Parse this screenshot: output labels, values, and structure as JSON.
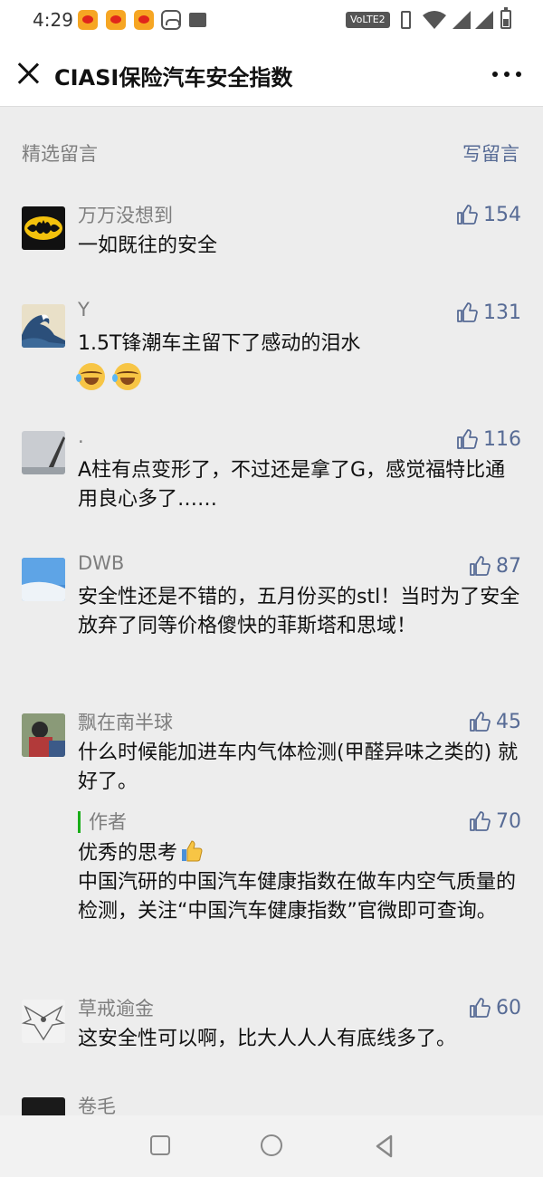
{
  "status_bar": {
    "time": "4:29",
    "network_badge": "VoLTE2",
    "icons": [
      "weibo-icon",
      "weibo-icon",
      "weibo-icon",
      "car-icon",
      "mail-icon",
      "vibrate-icon",
      "wifi-icon",
      "signal-icon",
      "signal-icon",
      "battery-icon"
    ]
  },
  "nav": {
    "title": "CIASI保险汽车安全指数",
    "close_icon": "close-icon",
    "more_icon": "more-icon"
  },
  "section": {
    "title": "精选留言",
    "write_label": "写留言"
  },
  "comments": [
    {
      "nickname": "万万没想到",
      "likes": "154",
      "text": "一如既往的安全"
    },
    {
      "nickname": "Y",
      "likes": "131",
      "text": "1.5T锋潮车主留下了感动的泪水"
    },
    {
      "nickname": ".",
      "likes": "116",
      "text": "A柱有点变形了，不过还是拿了G，感觉福特比通用良心多了……"
    },
    {
      "nickname": "DWB",
      "likes": "87",
      "text": "安全性还是不错的，五月份买的stl！当时为了安全放弃了同等价格傻快的菲斯塔和思域！"
    },
    {
      "nickname": "飘在南半球",
      "likes": "45",
      "text": "什么时候能加进车内气体检测(甲醛异味之类的) 就好了。",
      "reply": {
        "label": "作者",
        "likes": "70",
        "line1": "优秀的思考",
        "line2": "中国汽研的中国汽车健康指数在做车内空气质量的检测，关注“中国汽车健康指数”官微即可查询。"
      }
    },
    {
      "nickname": "草戒逾金",
      "likes": "60",
      "text": "这安全性可以啊，比大人人人有底线多了。"
    },
    {
      "nickname": "卷毛",
      "likes": "",
      "text": ""
    }
  ],
  "colors": {
    "link": "#576b95",
    "page_bg": "#ededed",
    "author_bar": "#1aad19",
    "meta_gray": "#7e7e7e"
  }
}
